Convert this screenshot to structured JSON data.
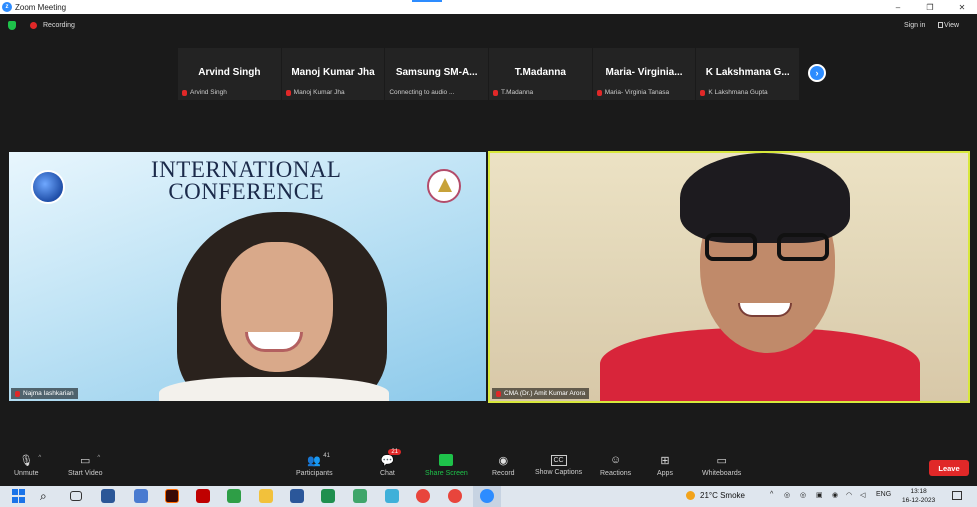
{
  "window": {
    "title": "Zoom Meeting"
  },
  "topbar": {
    "recording_label": "Recording",
    "signin_label": "Sign in",
    "view_label": "View"
  },
  "strip": {
    "tiles": [
      {
        "name": "Arvind Singh",
        "sub": "Arvind Singh"
      },
      {
        "name": "Manoj Kumar Jha",
        "sub": "Manoj Kumar Jha"
      },
      {
        "name": "Samsung  SM-A...",
        "sub": "Connecting to audio ..."
      },
      {
        "name": "T.Madanna",
        "sub": "T.Madanna"
      },
      {
        "name": "Maria-  Virginia...",
        "sub": "Maria- Virginia Tanasa"
      },
      {
        "name": "K Lakshmana G...",
        "sub": "K Lakshmana Gupta"
      }
    ],
    "next_label": "›"
  },
  "video_left": {
    "banner_line1": "INTERNATIONAL",
    "banner_line2": "CONFERENCE",
    "name_tag": "Najma Iashkarian"
  },
  "video_right": {
    "name_tag": "CMA (Dr.) Amit Kumar Arora"
  },
  "toolbar": {
    "unmute": "Unmute",
    "start_video": "Start Video",
    "participants": "Participants",
    "participants_count": "41",
    "chat": "Chat",
    "chat_badge": "21",
    "share_screen": "Share Screen",
    "record": "Record",
    "show_captions": "Show Captions",
    "captions_icon_text": "CC",
    "reactions": "Reactions",
    "apps": "Apps",
    "whiteboards": "Whiteboards",
    "leave": "Leave"
  },
  "taskbar": {
    "weather": "21°C  Smoke",
    "language": "ENG",
    "time": "13:18",
    "date": "16-12-2023"
  },
  "colors": {
    "zoom_blue": "#2d8cff",
    "recording_red": "#e02828",
    "share_green": "#1ec24a",
    "active_speaker": "#d8e83c"
  }
}
